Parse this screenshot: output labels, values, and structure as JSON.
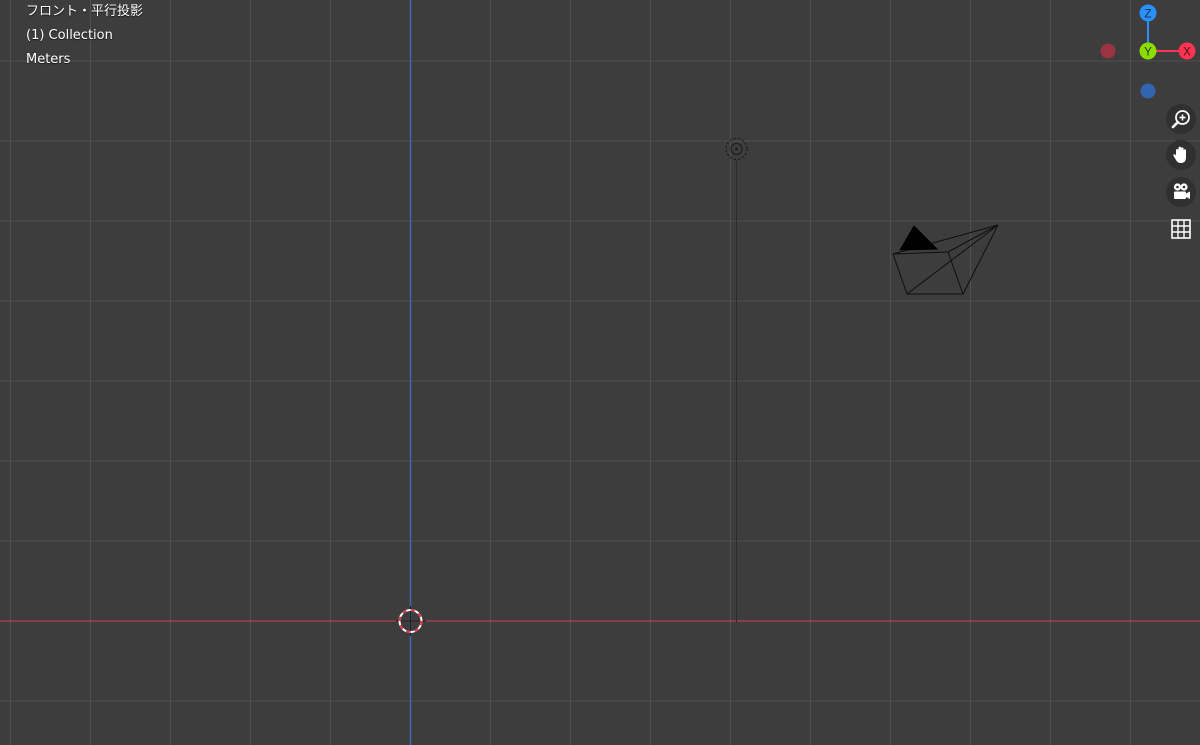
{
  "viewport": {
    "view_name": "フロント・平行投影",
    "collection_name": "(1) Collection",
    "units": "Meters"
  },
  "gizmo": {
    "z_label": "Z",
    "y_label": "Y",
    "x_label": "X",
    "colors": {
      "x": "#ff3352",
      "y": "#8bdc00",
      "z": "#2890ff",
      "x_neg": "#9c3343",
      "z_neg": "#3265b0"
    }
  },
  "navigation": {
    "zoom_icon": "zoom-in-icon",
    "pan_icon": "hand-icon",
    "camera_icon": "camera-icon",
    "ortho_icon": "grid-icon"
  },
  "theme": {
    "background": "#3d3d3d",
    "grid_line": "#505050",
    "x_axis": "#b6404f",
    "z_axis": "#3c6db6"
  }
}
